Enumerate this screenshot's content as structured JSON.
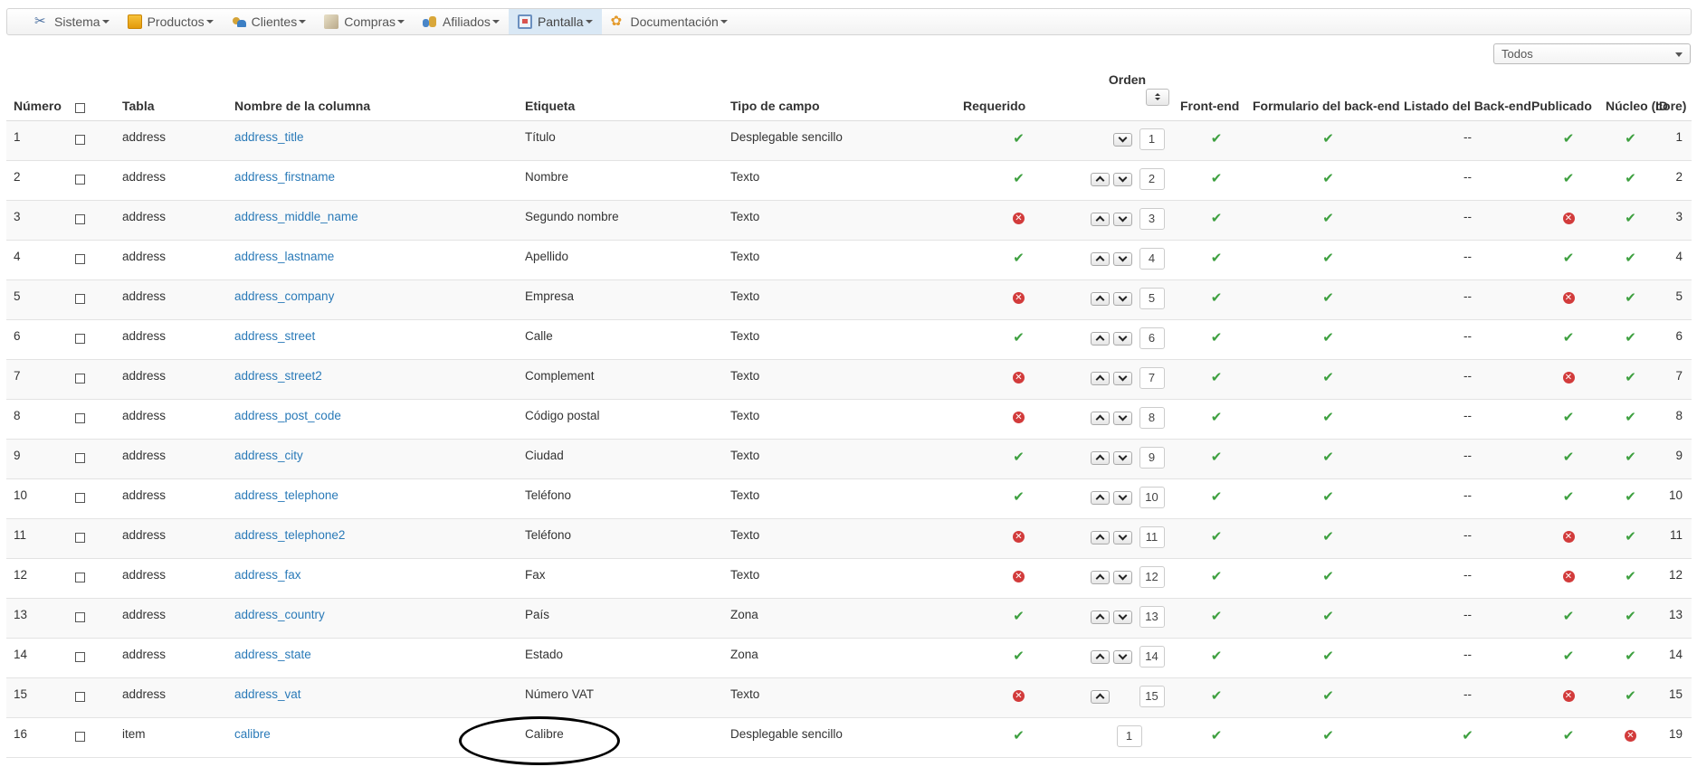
{
  "menu": [
    {
      "label": "Sistema",
      "icon": "tools-icon"
    },
    {
      "label": "Productos",
      "icon": "product-icon"
    },
    {
      "label": "Clientes",
      "icon": "clients-icon"
    },
    {
      "label": "Compras",
      "icon": "purchase-icon"
    },
    {
      "label": "Afiliados",
      "icon": "affiliates-icon"
    },
    {
      "label": "Pantalla",
      "icon": "screen-icon",
      "active": true
    },
    {
      "label": "Documentación",
      "icon": "documentation-icon"
    }
  ],
  "filter": {
    "selected": "Todos"
  },
  "table": {
    "headers": {
      "numero": "Número",
      "tabla": "Tabla",
      "columna": "Nombre de la columna",
      "etiqueta": "Etiqueta",
      "tipo": "Tipo de campo",
      "requerido": "Requerido",
      "orden": "Orden",
      "frontend": "Front-end",
      "form_backend": "Formulario del back-end",
      "list_backend": "Listado del Back-end",
      "publicado": "Publicado",
      "nucleo": "Núcleo (core)",
      "id": "ID"
    },
    "rows": [
      {
        "num": "1",
        "tabla": "address",
        "columna": "address_title",
        "etiqueta": "Título",
        "tipo": "Desplegable sencillo",
        "req": true,
        "orden": "1",
        "up": false,
        "down": true,
        "front": true,
        "form": true,
        "list": "--",
        "pub": true,
        "core": true,
        "id": "1"
      },
      {
        "num": "2",
        "tabla": "address",
        "columna": "address_firstname",
        "etiqueta": "Nombre",
        "tipo": "Texto",
        "req": true,
        "orden": "2",
        "up": true,
        "down": true,
        "front": true,
        "form": true,
        "list": "--",
        "pub": true,
        "core": true,
        "id": "2"
      },
      {
        "num": "3",
        "tabla": "address",
        "columna": "address_middle_name",
        "etiqueta": "Segundo nombre",
        "tipo": "Texto",
        "req": false,
        "orden": "3",
        "up": true,
        "down": true,
        "front": true,
        "form": true,
        "list": "--",
        "pub": false,
        "core": true,
        "id": "3"
      },
      {
        "num": "4",
        "tabla": "address",
        "columna": "address_lastname",
        "etiqueta": "Apellido",
        "tipo": "Texto",
        "req": true,
        "orden": "4",
        "up": true,
        "down": true,
        "front": true,
        "form": true,
        "list": "--",
        "pub": true,
        "core": true,
        "id": "4"
      },
      {
        "num": "5",
        "tabla": "address",
        "columna": "address_company",
        "etiqueta": "Empresa",
        "tipo": "Texto",
        "req": false,
        "orden": "5",
        "up": true,
        "down": true,
        "front": true,
        "form": true,
        "list": "--",
        "pub": false,
        "core": true,
        "id": "5"
      },
      {
        "num": "6",
        "tabla": "address",
        "columna": "address_street",
        "etiqueta": "Calle",
        "tipo": "Texto",
        "req": true,
        "orden": "6",
        "up": true,
        "down": true,
        "front": true,
        "form": true,
        "list": "--",
        "pub": true,
        "core": true,
        "id": "6"
      },
      {
        "num": "7",
        "tabla": "address",
        "columna": "address_street2",
        "etiqueta": "Complement",
        "tipo": "Texto",
        "req": false,
        "orden": "7",
        "up": true,
        "down": true,
        "front": true,
        "form": true,
        "list": "--",
        "pub": false,
        "core": true,
        "id": "7"
      },
      {
        "num": "8",
        "tabla": "address",
        "columna": "address_post_code",
        "etiqueta": "Código postal",
        "tipo": "Texto",
        "req": false,
        "orden": "8",
        "up": true,
        "down": true,
        "front": true,
        "form": true,
        "list": "--",
        "pub": true,
        "core": true,
        "id": "8"
      },
      {
        "num": "9",
        "tabla": "address",
        "columna": "address_city",
        "etiqueta": "Ciudad",
        "tipo": "Texto",
        "req": true,
        "orden": "9",
        "up": true,
        "down": true,
        "front": true,
        "form": true,
        "list": "--",
        "pub": true,
        "core": true,
        "id": "9"
      },
      {
        "num": "10",
        "tabla": "address",
        "columna": "address_telephone",
        "etiqueta": "Teléfono",
        "tipo": "Texto",
        "req": true,
        "orden": "10",
        "up": true,
        "down": true,
        "front": true,
        "form": true,
        "list": "--",
        "pub": true,
        "core": true,
        "id": "10"
      },
      {
        "num": "11",
        "tabla": "address",
        "columna": "address_telephone2",
        "etiqueta": "Teléfono",
        "tipo": "Texto",
        "req": false,
        "orden": "11",
        "up": true,
        "down": true,
        "front": true,
        "form": true,
        "list": "--",
        "pub": false,
        "core": true,
        "id": "11"
      },
      {
        "num": "12",
        "tabla": "address",
        "columna": "address_fax",
        "etiqueta": "Fax",
        "tipo": "Texto",
        "req": false,
        "orden": "12",
        "up": true,
        "down": true,
        "front": true,
        "form": true,
        "list": "--",
        "pub": false,
        "core": true,
        "id": "12"
      },
      {
        "num": "13",
        "tabla": "address",
        "columna": "address_country",
        "etiqueta": "País",
        "tipo": "Zona",
        "req": true,
        "orden": "13",
        "up": true,
        "down": true,
        "front": true,
        "form": true,
        "list": "--",
        "pub": true,
        "core": true,
        "id": "13"
      },
      {
        "num": "14",
        "tabla": "address",
        "columna": "address_state",
        "etiqueta": "Estado",
        "tipo": "Zona",
        "req": true,
        "orden": "14",
        "up": true,
        "down": true,
        "front": true,
        "form": true,
        "list": "--",
        "pub": true,
        "core": true,
        "id": "14"
      },
      {
        "num": "15",
        "tabla": "address",
        "columna": "address_vat",
        "etiqueta": "Número VAT",
        "tipo": "Texto",
        "req": false,
        "orden": "15",
        "up": true,
        "down": false,
        "front": true,
        "form": true,
        "list": "--",
        "pub": false,
        "core": true,
        "id": "15"
      },
      {
        "num": "16",
        "tabla": "item",
        "columna": "calibre",
        "etiqueta": "Calibre",
        "tipo": "Desplegable sencillo",
        "req": true,
        "orden": "1",
        "up": false,
        "down": false,
        "front": true,
        "form": true,
        "list": true,
        "pub": true,
        "core": false,
        "id": "19"
      }
    ]
  },
  "colors": {
    "link": "#2a7ab8",
    "check": "#3ea040",
    "cross": "#d23b3b",
    "active_menu": "#d9e8f5"
  }
}
